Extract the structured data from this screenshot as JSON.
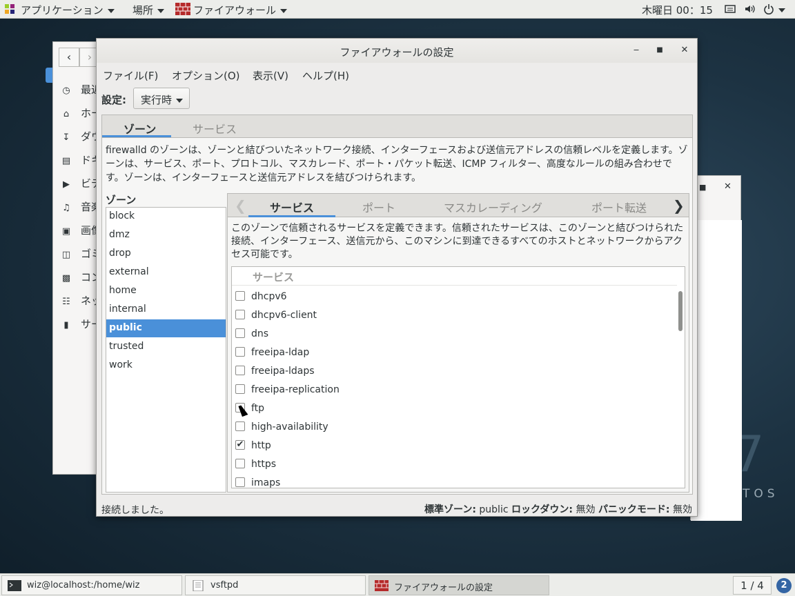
{
  "topbar": {
    "applications": "アプリケーション",
    "places": "場所",
    "app_menu": "ファイアウォール",
    "clock": "木曜日 00：15"
  },
  "desktop": {
    "brand": "TOS",
    "version_glyph": "7"
  },
  "nautilus": {
    "items": [
      {
        "label": "最近",
        "icon": "clock-icon"
      },
      {
        "label": "ホー",
        "icon": "home-icon"
      },
      {
        "label": "ダウ",
        "icon": "download-icon"
      },
      {
        "label": "ドキ",
        "icon": "document-icon"
      },
      {
        "label": "ビデ",
        "icon": "video-icon"
      },
      {
        "label": "音楽",
        "icon": "music-icon"
      },
      {
        "label": "画像",
        "icon": "camera-icon"
      },
      {
        "label": "ゴミ",
        "icon": "trash-icon"
      },
      {
        "label": "コン",
        "icon": "computer-icon"
      },
      {
        "label": "ネッ",
        "icon": "network-icon"
      },
      {
        "label": "サー",
        "icon": "server-icon"
      }
    ]
  },
  "window": {
    "title": "ファイアウォールの設定",
    "menu": [
      "ファイル(F)",
      "オプション(O)",
      "表示(V)",
      "ヘルプ(H)"
    ],
    "config_label": "設定:",
    "config_value": "実行時",
    "main_tabs": [
      "ゾーン",
      "サービス"
    ],
    "zone_description": "firewalld のゾーンは、ゾーンと結びついたネットワーク接続、インターフェースおよび送信元アドレスの信頼レベルを定義します。ゾーンは、サービス、ポート、プロトコル、マスカレード、ポート・パケット転送、ICMP フィルター、高度なルールの組み合わせです。ゾーンは、インターフェースと送信元アドレスを結びつけられます。",
    "zones_heading": "ゾーン",
    "zones": [
      "block",
      "dmz",
      "drop",
      "external",
      "home",
      "internal",
      "public",
      "trusted",
      "work"
    ],
    "selected_zone": "public",
    "sub_tabs": [
      "サービス",
      "ポート",
      "マスカレーディング",
      "ポート転送"
    ],
    "service_description": "このゾーンで信頼されるサービスを定義できます。信頼されたサービスは、このゾーンと結びつけられた接続、インターフェース、送信元から、このマシンに到達できるすべてのホストとネットワークからアクセス可能です。",
    "services_header": "サービス",
    "services": [
      {
        "name": "dhcpv6",
        "checked": false
      },
      {
        "name": "dhcpv6-client",
        "checked": false
      },
      {
        "name": "dns",
        "checked": false
      },
      {
        "name": "freeipa-ldap",
        "checked": false
      },
      {
        "name": "freeipa-ldaps",
        "checked": false
      },
      {
        "name": "freeipa-replication",
        "checked": false
      },
      {
        "name": "ftp",
        "checked": false
      },
      {
        "name": "high-availability",
        "checked": false
      },
      {
        "name": "http",
        "checked": true
      },
      {
        "name": "https",
        "checked": false
      },
      {
        "name": "imaps",
        "checked": false
      }
    ],
    "status": {
      "connected": "接続しました。",
      "default_zone_label": "標準ゾーン:",
      "default_zone": "public",
      "lockdown_label": "ロックダウン:",
      "lockdown": "無効",
      "panic_label": "パニックモード:",
      "panic": "無効"
    }
  },
  "taskbar": {
    "tasks": [
      {
        "label": "wiz@localhost:/home/wiz",
        "icon": "terminal-icon"
      },
      {
        "label": "vsftpd",
        "icon": "file-icon"
      },
      {
        "label": "ファイアウォールの設定",
        "icon": "firewall-icon"
      }
    ],
    "workspace": "1 / 4",
    "notifications": "2"
  }
}
